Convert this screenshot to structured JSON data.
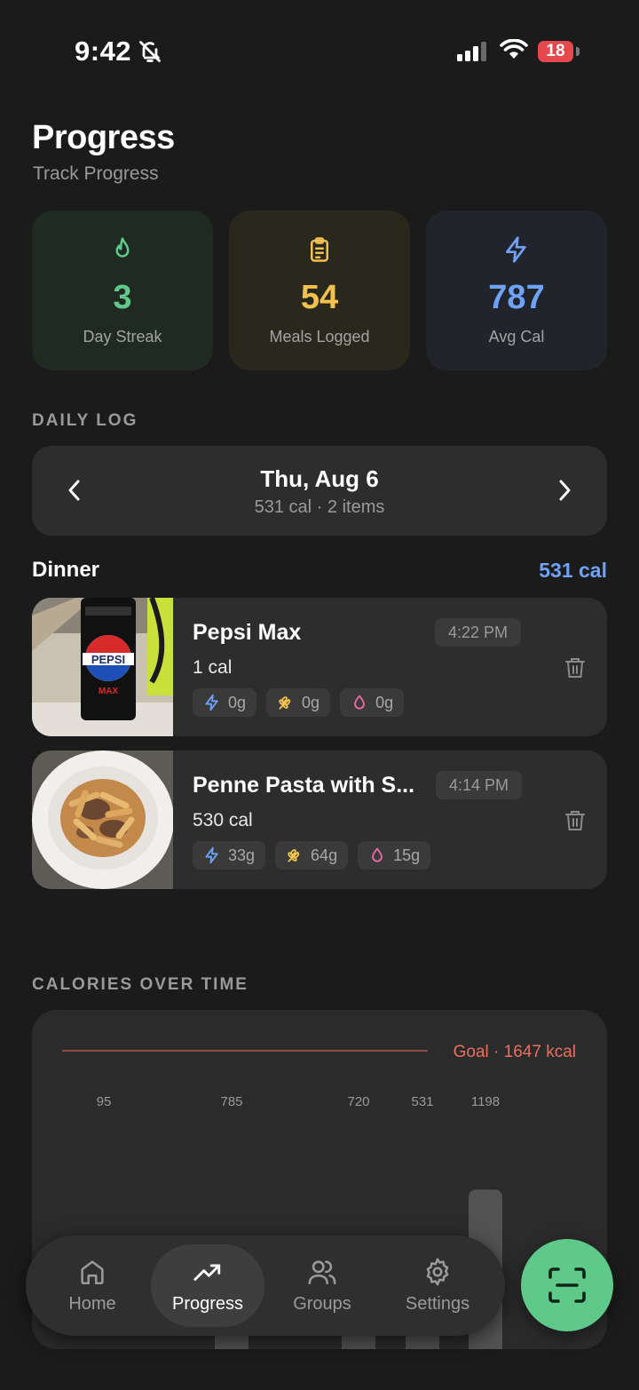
{
  "status_bar": {
    "time": "9:42",
    "battery": "18"
  },
  "header": {
    "title": "Progress",
    "subtitle": "Track Progress"
  },
  "stats": [
    {
      "value": "3",
      "label": "Day Streak",
      "icon": "flame-icon",
      "color": "#5fc98a",
      "bg": "#1f2a23"
    },
    {
      "value": "54",
      "label": "Meals Logged",
      "icon": "clipboard-icon",
      "color": "#f2c14e",
      "bg": "#2a271c"
    },
    {
      "value": "787",
      "label": "Avg Cal",
      "icon": "lightning-icon",
      "color": "#6ea2f5",
      "bg": "#22242c"
    }
  ],
  "daily_log": {
    "heading": "DAILY LOG",
    "date": "Thu, Aug 6",
    "summary": "531 cal · 2 items",
    "meal": {
      "name": "Dinner",
      "calories": "531 cal"
    },
    "items": [
      {
        "name": "Pepsi Max",
        "time": "4:22 PM",
        "calories": "1 cal",
        "protein": "0g",
        "carbs": "0g",
        "fat": "0g"
      },
      {
        "name": "Penne Pasta with S...",
        "time": "4:14 PM",
        "calories": "530 cal",
        "protein": "33g",
        "carbs": "64g",
        "fat": "15g"
      }
    ]
  },
  "chart_section": {
    "heading": "CALORIES OVER TIME"
  },
  "chart_data": {
    "type": "bar",
    "goal_label": "Goal · 1647 kcal",
    "goal": 1647,
    "values": [
      95,
      785,
      720,
      531,
      1198
    ],
    "value_labels": [
      "95",
      "785",
      "720",
      "531",
      "1198"
    ]
  },
  "tabbar": {
    "tabs": [
      {
        "label": "Home",
        "icon": "home-icon"
      },
      {
        "label": "Progress",
        "icon": "trending-up-icon"
      },
      {
        "label": "Groups",
        "icon": "users-icon"
      },
      {
        "label": "Settings",
        "icon": "gear-icon"
      }
    ]
  },
  "colors": {
    "accent_blue": "#6ea2f5",
    "goal_red": "#e9705f",
    "fab_green": "#5fc98a",
    "fat_pink": "#ec6aa5",
    "carb_yellow": "#f2c14e"
  }
}
